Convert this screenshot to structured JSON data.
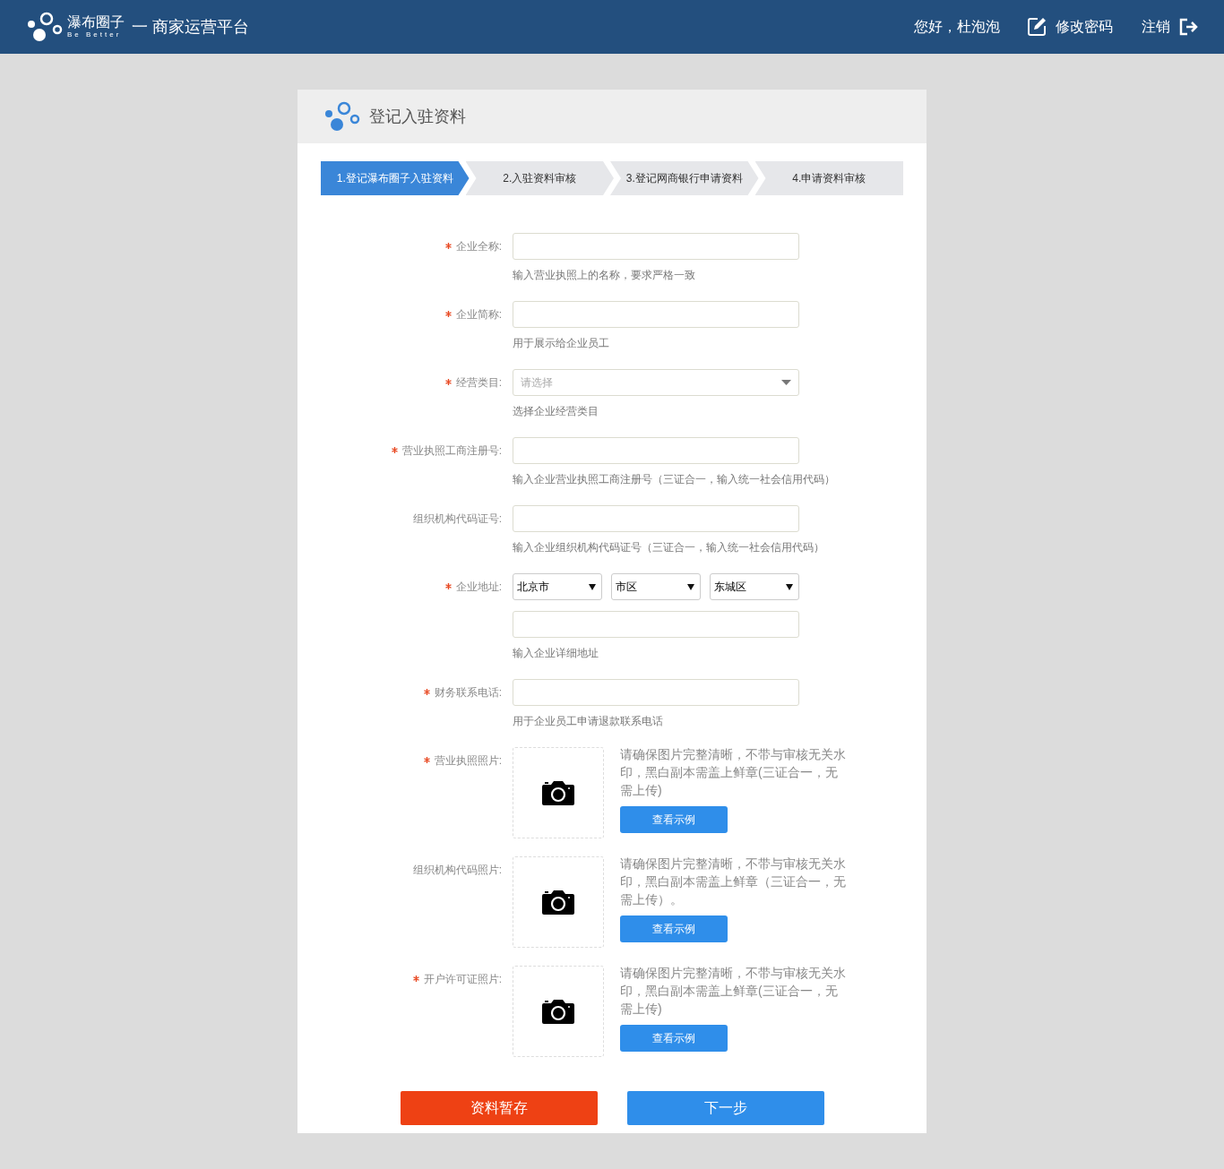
{
  "header": {
    "logo_name": "瀑布圈子",
    "logo_tagline": "Be Better",
    "platform": "一 商家运营平台",
    "greeting": "您好，杜泡泡",
    "change_password": "修改密码",
    "logout": "注销"
  },
  "card": {
    "title": "登记入驻资料"
  },
  "steps": [
    {
      "label": "1.登记瀑布圈子入驻资料",
      "selected": true
    },
    {
      "label": "2.入驻资料审核",
      "selected": false
    },
    {
      "label": "3.登记网商银行申请资料",
      "selected": false
    },
    {
      "label": "4.申请资料审核",
      "selected": false
    }
  ],
  "fields": [
    {
      "kind": "text",
      "label": "企业全称:",
      "required": true,
      "hint": "输入营业执照上的名称，要求严格一致"
    },
    {
      "kind": "text",
      "label": "企业简称:",
      "required": true,
      "hint": "用于展示给企业员工"
    },
    {
      "kind": "select",
      "label": "经营类目:",
      "required": true,
      "placeholder": "请选择",
      "hint": "选择企业经营类目"
    },
    {
      "kind": "text",
      "label": "营业执照工商注册号:",
      "required": true,
      "hint": "输入企业营业执照工商注册号（三证合一，输入统一社会信用代码）"
    },
    {
      "kind": "text",
      "label": "组织机构代码证号:",
      "required": false,
      "hint": "输入企业组织机构代码证号（三证合一，输入统一社会信用代码）"
    },
    {
      "kind": "address",
      "label": "企业地址:",
      "required": true,
      "selects": [
        "北京市",
        "市区",
        "东城区"
      ],
      "hint": "输入企业详细地址"
    },
    {
      "kind": "text",
      "label": "财务联系电话:",
      "required": true,
      "hint": "用于企业员工申请退款联系电话"
    },
    {
      "kind": "photo",
      "label": "营业执照照片:",
      "required": true,
      "note": "请确保图片完整清晰，不带与审核无关水印，黑白副本需盖上鲜章(三证合一，无需上传)",
      "button": "查看示例"
    },
    {
      "kind": "photo",
      "label": "组织机构代码照片:",
      "required": false,
      "note": "请确保图片完整清晰，不带与审核无关水印，黑白副本需盖上鲜章（三证合一，无需上传）。",
      "button": "查看示例"
    },
    {
      "kind": "photo",
      "label": "开户许可证照片:",
      "required": true,
      "note": "请确保图片完整清晰，不带与审核无关水印，黑白副本需盖上鲜章(三证合一，无需上传)",
      "button": "查看示例"
    }
  ],
  "actions": {
    "save": "资料暂存",
    "next": "下一步"
  }
}
